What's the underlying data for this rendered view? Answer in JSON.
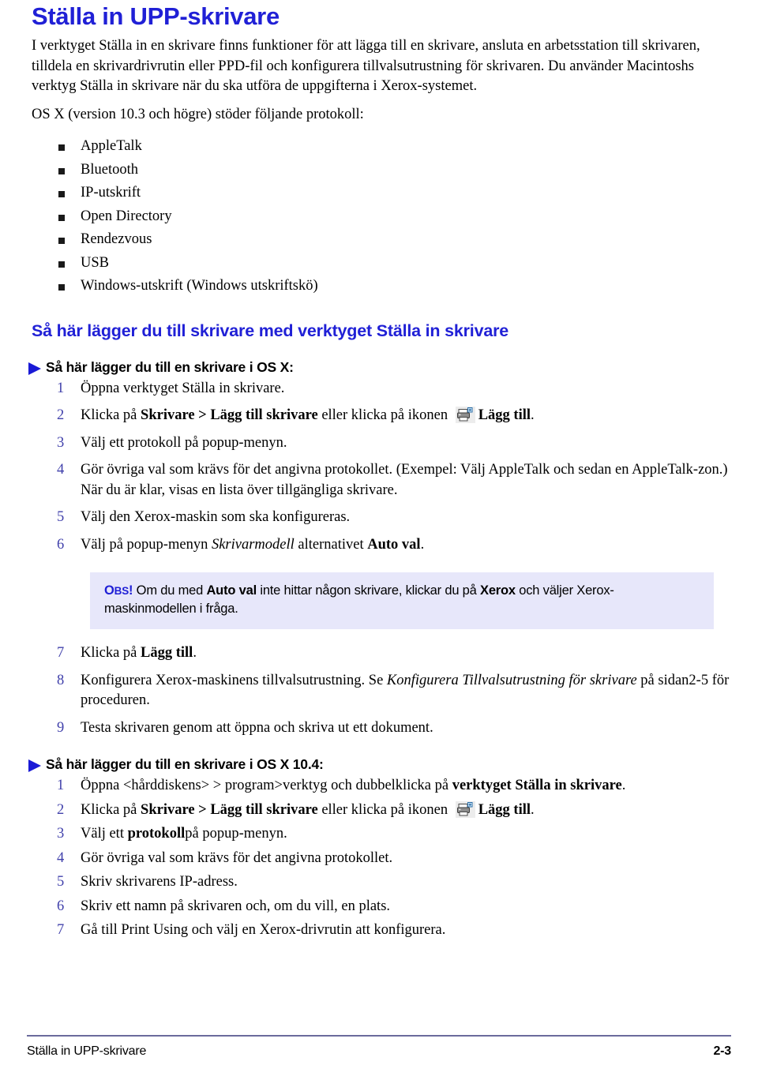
{
  "document": {
    "title": "Ställa in UPP-skrivare",
    "intro_paragraph": "I verktyget Ställa in en skrivare finns funktioner för att lägga till en skrivare, ansluta en arbetsstation till skrivaren, tilldela en skrivardrivrutin eller PPD-fil och konfigurera tillvalsutrustning för skrivaren. Du använder Macintoshs verktyg Ställa in skrivare när du ska utföra de uppgifterna i Xerox-systemet.",
    "protocols_intro": "OS X (version 10.3 och högre) stöder följande protokoll:",
    "protocols": [
      "AppleTalk",
      "Bluetooth",
      "IP-utskrift",
      "Open Directory",
      "Rendezvous",
      "USB",
      "Windows-utskrift (Windows utskriftskö)"
    ],
    "section_heading": "Så här lägger du till skrivare med verktyget Ställa in skrivare",
    "procedure_osx": {
      "heading": "Så här lägger du till en skrivare i OS X:",
      "steps": [
        {
          "number": "1",
          "parts": [
            {
              "text": "Öppna verktyget Ställa in skrivare.",
              "style": "normal"
            }
          ]
        },
        {
          "number": "2",
          "parts": [
            {
              "text": "Klicka på ",
              "style": "normal"
            },
            {
              "text": "Skrivare > Lägg till skrivare",
              "style": "bold"
            },
            {
              "text": " eller klicka på ikonen ",
              "style": "normal"
            },
            {
              "text": "",
              "style": "icon",
              "icon": "printer-add-icon"
            },
            {
              "text": "Lägg till",
              "style": "bold"
            },
            {
              "text": ".",
              "style": "normal"
            }
          ]
        },
        {
          "number": "3",
          "parts": [
            {
              "text": "Välj  ett protokoll på popup-menyn.",
              "style": "normal"
            }
          ]
        },
        {
          "number": "4",
          "parts": [
            {
              "text": "Gör övriga val som krävs för det angivna protokollet. (Exempel: Välj AppleTalk och sedan en AppleTalk-zon.) När du är klar, visas en lista över tillgängliga skrivare.",
              "style": "normal"
            }
          ]
        },
        {
          "number": "5",
          "parts": [
            {
              "text": "Välj den Xerox-maskin som ska konfigureras.",
              "style": "normal"
            }
          ]
        },
        {
          "number": "6",
          "parts": [
            {
              "text": "Välj på popup-menyn ",
              "style": "normal"
            },
            {
              "text": "Skrivarmodell",
              "style": "italic"
            },
            {
              "text": " alternativet ",
              "style": "normal"
            },
            {
              "text": "Auto val",
              "style": "bold"
            },
            {
              "text": ".",
              "style": "normal"
            }
          ]
        }
      ],
      "steps_after_note": [
        {
          "number": "7",
          "parts": [
            {
              "text": "Klicka på ",
              "style": "normal"
            },
            {
              "text": "Lägg till",
              "style": "bold"
            },
            {
              "text": ".",
              "style": "normal"
            }
          ]
        },
        {
          "number": "8",
          "parts": [
            {
              "text": "Konfigurera Xerox-maskinens tillvalsutrustning. Se ",
              "style": "normal"
            },
            {
              "text": "Konfigurera Tillvalsutrustning för skrivare",
              "style": "italic"
            },
            {
              "text": " på sidan2-5 för proceduren.",
              "style": "normal"
            }
          ]
        },
        {
          "number": "9",
          "parts": [
            {
              "text": "Testa skrivaren genom att öppna och skriva ut ett dokument.",
              "style": "normal"
            }
          ]
        }
      ]
    },
    "note": {
      "label_first": "O",
      "label_rest": "BS",
      "label_mark": "!",
      "parts": [
        {
          "text": " Om du med ",
          "style": "normal"
        },
        {
          "text": "Auto val",
          "style": "bold"
        },
        {
          "text": " inte hittar någon skrivare, klickar du på ",
          "style": "normal"
        },
        {
          "text": "Xerox",
          "style": "bold"
        },
        {
          "text": " och väljer Xerox-maskinmodellen i fråga.",
          "style": "normal"
        }
      ]
    },
    "procedure_osx104": {
      "heading": "Så här lägger du till en skrivare i OS X 10.4:",
      "steps": [
        {
          "number": "1",
          "parts": [
            {
              "text": "Öppna <hårddiskens> > program>verktyg och dubbelklicka på ",
              "style": "normal"
            },
            {
              "text": "verktyget Ställa in skrivare",
              "style": "bold"
            },
            {
              "text": ".",
              "style": "normal"
            }
          ]
        },
        {
          "number": "2",
          "parts": [
            {
              "text": "Klicka på ",
              "style": "normal"
            },
            {
              "text": "Skrivare > Lägg till skrivare",
              "style": "bold"
            },
            {
              "text": " eller klicka på ikonen ",
              "style": "normal"
            },
            {
              "text": "",
              "style": "icon",
              "icon": "printer-add-icon"
            },
            {
              "text": "Lägg till",
              "style": "bold"
            },
            {
              "text": ".",
              "style": "normal"
            }
          ]
        },
        {
          "number": "3",
          "parts": [
            {
              "text": "Välj ett ",
              "style": "normal"
            },
            {
              "text": "protokoll",
              "style": "bold"
            },
            {
              "text": "på popup-menyn.",
              "style": "normal"
            }
          ]
        },
        {
          "number": "4",
          "parts": [
            {
              "text": "Gör övriga val som krävs för det angivna protokollet.",
              "style": "normal"
            }
          ]
        },
        {
          "number": "5",
          "parts": [
            {
              "text": "Skriv skrivarens IP-adress.",
              "style": "normal"
            }
          ]
        },
        {
          "number": "6",
          "parts": [
            {
              "text": "Skriv ett namn på skrivaren och, om du vill, en plats.",
              "style": "normal"
            }
          ]
        },
        {
          "number": "7",
          "parts": [
            {
              "text": "Gå till Print Using och välj en Xerox-drivrutin att konfigurera.",
              "style": "normal"
            }
          ]
        }
      ]
    },
    "footer": {
      "left": "Ställa in UPP-skrivare",
      "page": "2-3"
    },
    "colors": {
      "heading_blue": "#2020d6",
      "step_number_blue": "#4141ab",
      "note_background": "#e7e7fa",
      "footer_rule": "#6a6a9c",
      "bullet_black": "#1a1a1a"
    }
  }
}
